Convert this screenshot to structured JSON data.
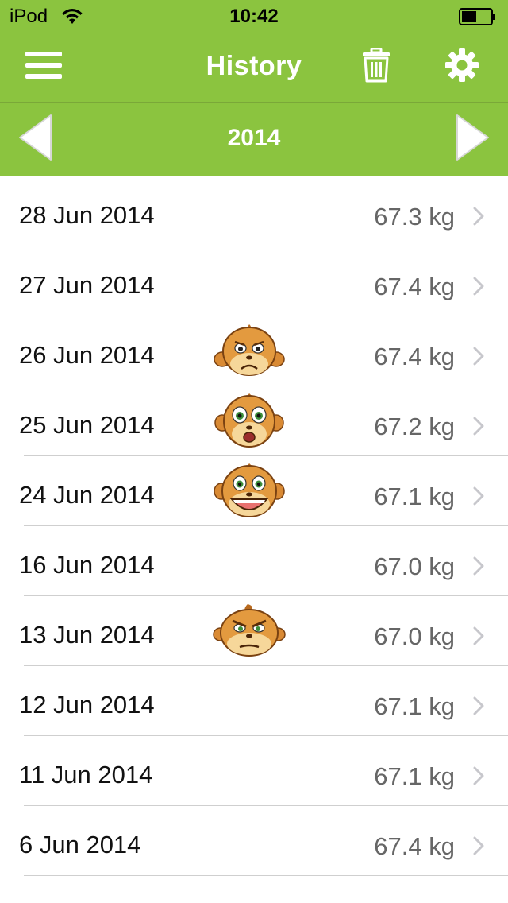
{
  "status_bar": {
    "carrier": "iPod",
    "time": "10:42"
  },
  "nav": {
    "title": "History",
    "menu_icon": "hamburger-menu-icon",
    "trash_icon": "trash-icon",
    "settings_icon": "gear-icon"
  },
  "year_bar": {
    "year": "2014",
    "prev_icon": "triangle-left-icon",
    "next_icon": "triangle-right-icon"
  },
  "colors": {
    "header_green": "#8bc43f",
    "text_dark": "#111111",
    "text_gray": "#666666",
    "separator": "#cfcfcf"
  },
  "entries": [
    {
      "date": "28 Jun 2014",
      "weight": "67.3 kg",
      "mood": null
    },
    {
      "date": "27 Jun 2014",
      "weight": "67.4 kg",
      "mood": null
    },
    {
      "date": "26 Jun 2014",
      "weight": "67.4 kg",
      "mood": "sad"
    },
    {
      "date": "25 Jun 2014",
      "weight": "67.2 kg",
      "mood": "surprised"
    },
    {
      "date": "24 Jun 2014",
      "weight": "67.1 kg",
      "mood": "happy"
    },
    {
      "date": "16 Jun 2014",
      "weight": "67.0 kg",
      "mood": null
    },
    {
      "date": "13 Jun 2014",
      "weight": "67.0 kg",
      "mood": "angry"
    },
    {
      "date": "12 Jun 2014",
      "weight": "67.1 kg",
      "mood": null
    },
    {
      "date": "11 Jun 2014",
      "weight": "67.1 kg",
      "mood": null
    },
    {
      "date": "6 Jun 2014",
      "weight": "67.4 kg",
      "mood": null
    }
  ]
}
